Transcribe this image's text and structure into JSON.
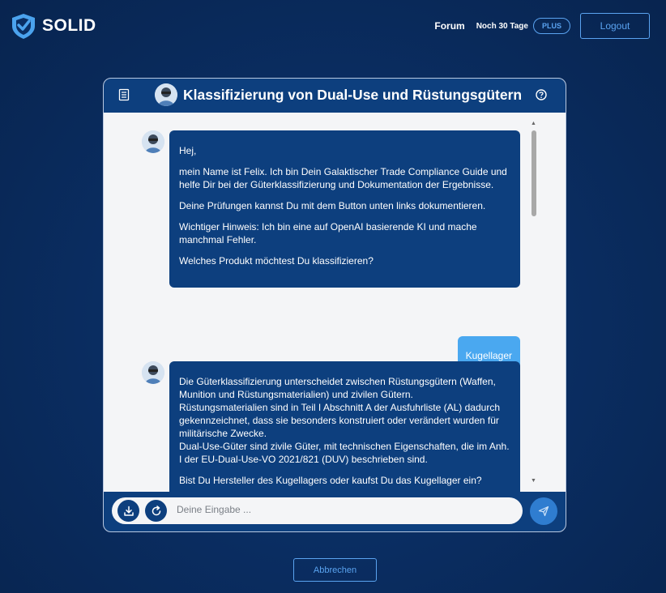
{
  "header": {
    "brand": "SOLID",
    "nav_forum": "Forum",
    "subscription_days": "Noch 30 Tage",
    "plan_badge": "PLUS",
    "logout_label": "Logout"
  },
  "chat": {
    "title": "Klassifizierung von Dual-Use und Rüstungsgütern",
    "menu_icon": "list-icon",
    "help_icon": "question-icon",
    "messages": [
      {
        "role": "bot",
        "paragraphs": [
          "Hej,",
          "mein Name ist Felix. Ich bin Dein Galaktischer Trade Compliance Guide und helfe Dir bei der Güterklassifizierung und Dokumentation der Ergebnisse.",
          "Deine Prüfungen kannst Du mit dem Button unten links dokumentieren.",
          "Wichtiger Hinweis: Ich bin eine auf OpenAI basierende KI und mache manchmal Fehler.",
          "Welches Produkt möchtest Du klassifizieren?"
        ]
      },
      {
        "role": "user",
        "text": "Kugellager"
      },
      {
        "role": "bot",
        "paragraphs": [
          "Die Güterklassifizierung unterscheidet zwischen Rüstungsgütern (Waffen, Munition und Rüstungsmaterialien) und zivilen Gütern.",
          "Rüstungsmaterialien sind in Teil I Abschnitt A der Ausfuhrliste (AL) dadurch gekennzeichnet, dass sie besonders konstruiert oder verändert wurden für militärische Zwecke.",
          "Dual-Use-Güter sind zivile Güter, mit technischen Eigenschaften, die im Anh. I der EU-Dual-Use-VO 2021/821 (DUV) beschrieben sind.",
          "Bist Du Hersteller des Kugellagers oder kaufst Du das Kugellager ein?"
        ]
      }
    ],
    "input": {
      "placeholder": "Deine Eingabe ...",
      "value": ""
    },
    "download_icon": "download-icon",
    "refresh_icon": "refresh-icon",
    "send_icon": "send-icon"
  },
  "cancel_label": "Abbrechen",
  "colors": {
    "background": "#0a2e63",
    "header_bar": "#0d3f7e",
    "user_bubble": "#4aa8f0",
    "accent": "#5aa3f0"
  }
}
